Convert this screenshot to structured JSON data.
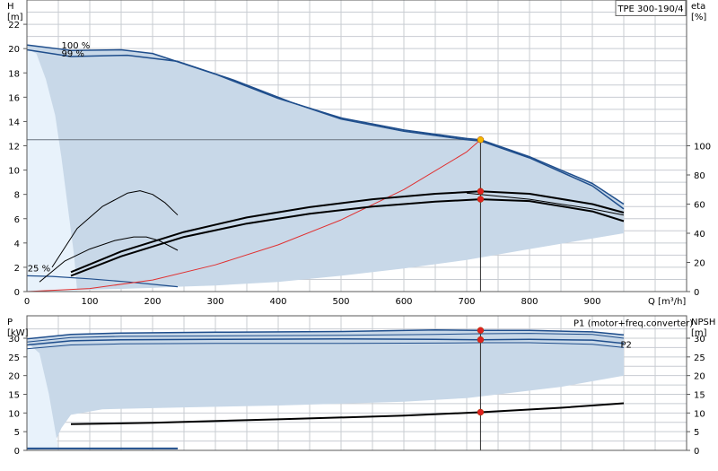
{
  "chart_data": [
    {
      "type": "line",
      "model_label": "TPE 300-190/4",
      "ylabel_left": "H",
      "ylabel_left_unit": "[m]",
      "ylabel_right": "eta",
      "ylabel_right_unit": "[%]",
      "xlabel": "Q [m³/h]",
      "xlim": [
        0,
        1050
      ],
      "ylim_left": [
        0,
        24
      ],
      "ylim_right": [
        0,
        200
      ],
      "x_ticks": [
        0,
        100,
        200,
        300,
        400,
        500,
        600,
        700,
        800,
        900
      ],
      "y_ticks_left": [
        0,
        2,
        4,
        6,
        8,
        10,
        12,
        14,
        16,
        18,
        20,
        22
      ],
      "y_ticks_right": [
        0,
        20,
        40,
        60,
        80,
        100
      ],
      "grid": true,
      "curve_labels": [
        {
          "text": "100 %",
          "x": 55,
          "y": 20.0
        },
        {
          "text": "99 %",
          "x": 55,
          "y": 19.35
        },
        {
          "text": "25 %",
          "x": 1,
          "y": 1.65
        }
      ],
      "operating_point": {
        "x": 722,
        "y": 12.5
      },
      "series": [
        {
          "role": "operating_range_outer",
          "color": "#c8d8e8",
          "x": [
            0,
            60,
            150,
            200,
            300,
            400,
            500,
            600,
            700,
            720,
            800,
            900,
            950,
            950,
            800,
            700,
            600,
            500,
            400,
            300,
            240,
            200,
            100,
            30,
            0
          ],
          "y": [
            20.3,
            19.8,
            19.9,
            19.6,
            17.9,
            15.9,
            14.3,
            13.3,
            12.6,
            12.5,
            11.1,
            8.9,
            7.2,
            4.8,
            3.5,
            2.6,
            1.9,
            1.3,
            0.8,
            0.5,
            0.4,
            0.3,
            0.15,
            0.05,
            0
          ]
        },
        {
          "role": "inner_boundary",
          "color": "#e8f2fb",
          "x": [
            0,
            15,
            30,
            45,
            55,
            65,
            75,
            80,
            0
          ],
          "y": [
            20.0,
            19.6,
            17.5,
            14.5,
            11.0,
            7.0,
            3.0,
            0,
            0
          ]
        },
        {
          "role": "qh_max",
          "color": "#1f4e8c",
          "width": 1.5,
          "x": [
            0,
            70,
            150,
            200,
            300,
            400,
            500,
            600,
            700,
            722,
            800,
            900,
            950
          ],
          "y": [
            20.3,
            19.85,
            19.9,
            19.6,
            17.9,
            15.9,
            14.3,
            13.3,
            12.6,
            12.5,
            11.1,
            8.9,
            7.2
          ]
        },
        {
          "role": "qh_99",
          "color": "#1f4e8c",
          "width": 1.5,
          "x": [
            0,
            70,
            160,
            240,
            330,
            420,
            500,
            600,
            700,
            722,
            800,
            900,
            950
          ],
          "y": [
            19.9,
            19.35,
            19.45,
            18.95,
            17.4,
            15.6,
            14.2,
            13.2,
            12.5,
            12.4,
            11.0,
            8.7,
            6.8
          ]
        },
        {
          "role": "qh_min_25",
          "color": "#1f4e8c",
          "width": 1.2,
          "x": [
            0,
            40,
            100,
            160,
            200,
            240
          ],
          "y": [
            1.3,
            1.25,
            1.05,
            0.8,
            0.6,
            0.4
          ]
        },
        {
          "role": "system_curve",
          "color": "#e03030",
          "width": 1,
          "x": [
            0,
            100,
            200,
            300,
            400,
            500,
            600,
            700,
            722
          ],
          "y": [
            0,
            0.25,
            0.95,
            2.2,
            3.85,
            5.9,
            8.4,
            11.5,
            12.5
          ]
        },
        {
          "role": "eta_total_upper",
          "color": "#000000",
          "width": 2,
          "x": [
            70,
            150,
            250,
            350,
            450,
            550,
            650,
            722,
            800,
            900,
            950
          ],
          "y": [
            1.6,
            3.3,
            4.9,
            6.1,
            6.95,
            7.6,
            8.05,
            8.25,
            8.05,
            7.2,
            6.5
          ]
        },
        {
          "role": "eta_total_lower",
          "color": "#000000",
          "width": 2,
          "x": [
            70,
            150,
            250,
            350,
            450,
            550,
            650,
            722,
            800,
            900,
            950
          ],
          "y": [
            1.3,
            2.9,
            4.5,
            5.6,
            6.4,
            7.0,
            7.4,
            7.6,
            7.45,
            6.6,
            5.8
          ]
        },
        {
          "role": "eta_upper_extra",
          "color": "#000000",
          "width": 1,
          "x": [
            700,
            800,
            900,
            950
          ],
          "y": [
            8.1,
            7.6,
            6.8,
            6.3
          ]
        },
        {
          "role": "eta_low_speed_a",
          "color": "#000000",
          "width": 1,
          "x": [
            40,
            80,
            120,
            160,
            180,
            200,
            220,
            240
          ],
          "y": [
            2.0,
            5.2,
            7.0,
            8.1,
            8.3,
            8.0,
            7.3,
            6.3
          ]
        },
        {
          "role": "eta_low_speed_b",
          "color": "#000000",
          "width": 1,
          "x": [
            20,
            60,
            100,
            140,
            170,
            190,
            210,
            240
          ],
          "y": [
            0.8,
            2.5,
            3.5,
            4.2,
            4.5,
            4.5,
            4.2,
            3.4
          ]
        }
      ],
      "markers": [
        {
          "x": 722,
          "y": 12.5,
          "color": "#f5b800"
        },
        {
          "x": 722,
          "y": 8.25,
          "color": "#e02020"
        },
        {
          "x": 722,
          "y": 7.6,
          "color": "#e02020"
        }
      ]
    },
    {
      "type": "line",
      "ylabel_left": "P",
      "ylabel_left_unit": "[kW]",
      "ylabel_right": "NPSH",
      "ylabel_right_unit": "[m]",
      "xlim": [
        0,
        1050
      ],
      "ylim_left": [
        0,
        36
      ],
      "ylim_right": [
        0,
        36
      ],
      "y_ticks_left": [
        0,
        5,
        10,
        15,
        20,
        25,
        30
      ],
      "y_ticks_right": [
        0,
        5,
        10,
        15,
        20,
        25,
        30
      ],
      "grid": true,
      "curve_labels": [
        {
          "text": "P1 (motor+freq.converter)",
          "x": 870,
          "y": 33.2
        },
        {
          "text": "P2",
          "x": 945,
          "y": 27.5
        }
      ],
      "series": [
        {
          "role": "power_area",
          "color": "#c8d8e8",
          "x": [
            0,
            60,
            160,
            300,
            500,
            650,
            722,
            850,
            950,
            950,
            850,
            700,
            600,
            400,
            250,
            120,
            70,
            55,
            40,
            0
          ],
          "y": [
            29.5,
            31.0,
            31.5,
            31.6,
            31.8,
            32.2,
            32.1,
            32.0,
            31.0,
            20.0,
            17.0,
            14.0,
            13.0,
            12.0,
            11.5,
            11.0,
            9.5,
            6.0,
            0.5,
            0
          ]
        },
        {
          "role": "power_inner",
          "color": "#e8f2fb",
          "x": [
            0,
            20,
            35,
            50,
            0
          ],
          "y": [
            29.0,
            26.0,
            15.0,
            0.5,
            0
          ]
        },
        {
          "role": "p1_max",
          "color": "#1f4e8c",
          "width": 1.5,
          "x": [
            0,
            70,
            150,
            300,
            500,
            650,
            722,
            800,
            900,
            950
          ],
          "y": [
            29.8,
            31.0,
            31.4,
            31.6,
            31.8,
            32.2,
            32.1,
            32.1,
            31.7,
            30.9
          ]
        },
        {
          "role": "p1_99",
          "color": "#1f4e8c",
          "width": 1,
          "x": [
            0,
            70,
            150,
            300,
            500,
            650,
            722,
            800,
            900,
            950
          ],
          "y": [
            29.0,
            30.2,
            30.5,
            30.6,
            30.8,
            31.0,
            31.2,
            31.3,
            31.0,
            30.0
          ]
        },
        {
          "role": "p2_max",
          "color": "#1f4e8c",
          "width": 1.5,
          "x": [
            0,
            70,
            150,
            300,
            500,
            650,
            722,
            800,
            900,
            950
          ],
          "y": [
            28.2,
            29.3,
            29.6,
            29.7,
            29.8,
            29.7,
            29.6,
            29.7,
            29.5,
            28.6
          ]
        },
        {
          "role": "p2_99",
          "color": "#1f4e8c",
          "width": 1,
          "x": [
            0,
            70,
            150,
            300,
            500,
            650,
            722,
            800,
            900,
            950
          ],
          "y": [
            27.2,
            28.2,
            28.5,
            28.6,
            28.6,
            28.7,
            28.8,
            28.8,
            28.4,
            27.5
          ]
        },
        {
          "role": "npsh",
          "color": "#000000",
          "width": 2,
          "x": [
            70,
            200,
            400,
            600,
            722,
            850,
            950
          ],
          "y": [
            7.0,
            7.4,
            8.3,
            9.3,
            10.2,
            11.4,
            12.6
          ]
        },
        {
          "role": "low_speed_power",
          "color": "#1f4e8c",
          "width": 2,
          "x": [
            0,
            240
          ],
          "y": [
            0.5,
            0.5
          ]
        }
      ],
      "markers": [
        {
          "x": 722,
          "y": 32.1,
          "color": "#e02020"
        },
        {
          "x": 722,
          "y": 29.6,
          "color": "#e02020"
        },
        {
          "x": 722,
          "y": 10.2,
          "color": "#e02020"
        }
      ]
    }
  ]
}
